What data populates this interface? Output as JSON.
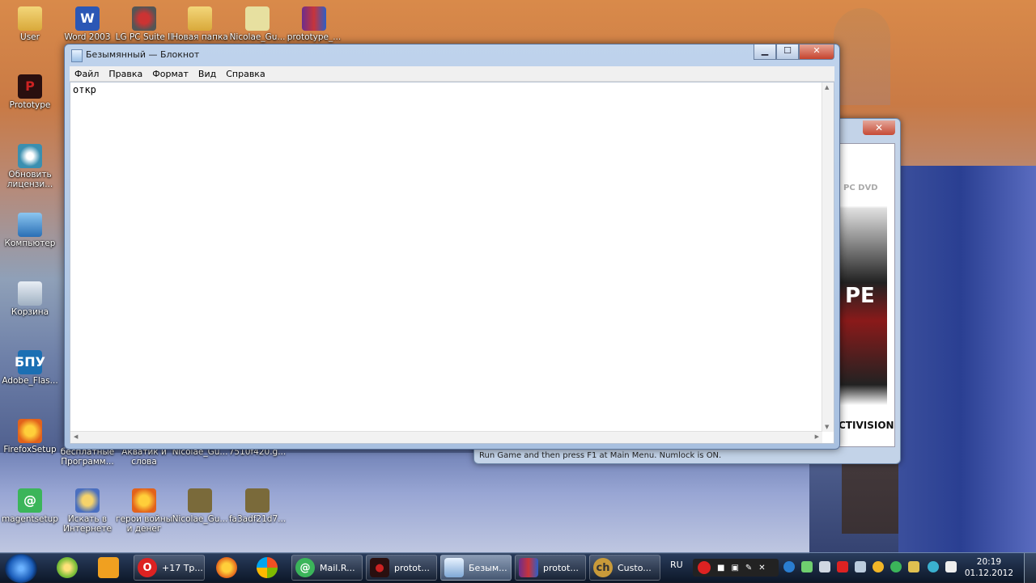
{
  "desktop": {
    "icons_top": [
      {
        "label": "User",
        "icon": "folder-icon",
        "x": 0
      },
      {
        "label": "Word 2003",
        "icon": "word-icon",
        "x": 0
      },
      {
        "label": "LG PC Suite II",
        "icon": "lg-icon",
        "x": 0
      },
      {
        "label": "Новая папка",
        "icon": "folder-icon",
        "x": 0
      },
      {
        "label": "Nicolae_Gu...",
        "icon": "file-icon",
        "x": 0
      },
      {
        "label": "prototype_...",
        "icon": "winrar-icon",
        "x": 0
      }
    ],
    "icons_left": [
      {
        "label": "Prototype"
      },
      {
        "label": "Обновить лицензи..."
      },
      {
        "label": "Компьютер"
      },
      {
        "label": "Корзина"
      },
      {
        "label": "Adobe_Flas..."
      },
      {
        "label": "FirefoxSetup"
      }
    ],
    "icons_row2": [
      {
        "label": "бесплатные Программ..."
      },
      {
        "label": "Акватик и слова"
      },
      {
        "label": "Nicolae_Gu..."
      },
      {
        "label": "7510f420.g..."
      }
    ],
    "icons_bottom": [
      {
        "label": "magentsetup"
      },
      {
        "label": "Искать в Интернете"
      },
      {
        "label": "герои войны и денег"
      },
      {
        "label": "Nicolae_Gu..."
      },
      {
        "label": "fa3adf21d7..."
      }
    ]
  },
  "back_window": {
    "close_label": "✕",
    "poster_top": "PC DVD",
    "poster_mid": "PE",
    "poster_bottom": "CTIVISION",
    "status": "Run Game and then press F1 at Main Menu. Numlock is ON."
  },
  "notepad": {
    "title": "Безымянный — Блокнот",
    "min_label": "▁",
    "max_label": "☐",
    "close_label": "✕",
    "menu": [
      "Файл",
      "Правка",
      "Формат",
      "Вид",
      "Справка"
    ],
    "content": "откр"
  },
  "taskbar": {
    "buttons": [
      {
        "label": "+17 Тр..."
      },
      {
        "label": "Mail.R..."
      },
      {
        "label": "protot..."
      },
      {
        "label": "Безым..."
      },
      {
        "label": "protot..."
      },
      {
        "label": "Custo..."
      }
    ],
    "lang": "RU",
    "time": "20:19",
    "date": "01.12.2012"
  }
}
